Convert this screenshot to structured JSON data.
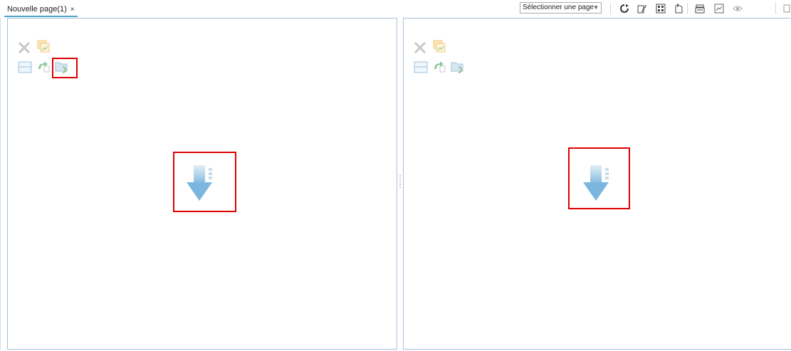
{
  "tab": {
    "label": "Nouvelle page(1)",
    "close_icon": "×"
  },
  "toolbar": {
    "page_select": {
      "value": "Sélectionner une page",
      "arrow": "▼"
    },
    "icons": [
      "refresh-icon",
      "edit-page-icon",
      "grid-layout-icon",
      "new-page-icon",
      "page-settings-icon",
      "image-icon",
      "eye-icon",
      "overflow-icon"
    ]
  },
  "panes": [
    {
      "id": "left",
      "icons": [
        "close-x-icon",
        "copy-image-icon",
        "split-horizontal-icon",
        "undo-icon",
        "folder-refresh-icon"
      ],
      "highlighted": [
        "folder-refresh-icon",
        "drop-download-icon"
      ]
    },
    {
      "id": "right",
      "icons": [
        "close-x-icon",
        "copy-image-icon",
        "split-horizontal-icon",
        "undo-icon",
        "folder-refresh-icon"
      ],
      "highlighted": [
        "drop-download-icon"
      ]
    }
  ],
  "colors": {
    "accent": "#4fa4c8",
    "highlight": "#e00000",
    "arrow_top": "#dbe9f4",
    "arrow_bottom": "#7bb8df"
  }
}
